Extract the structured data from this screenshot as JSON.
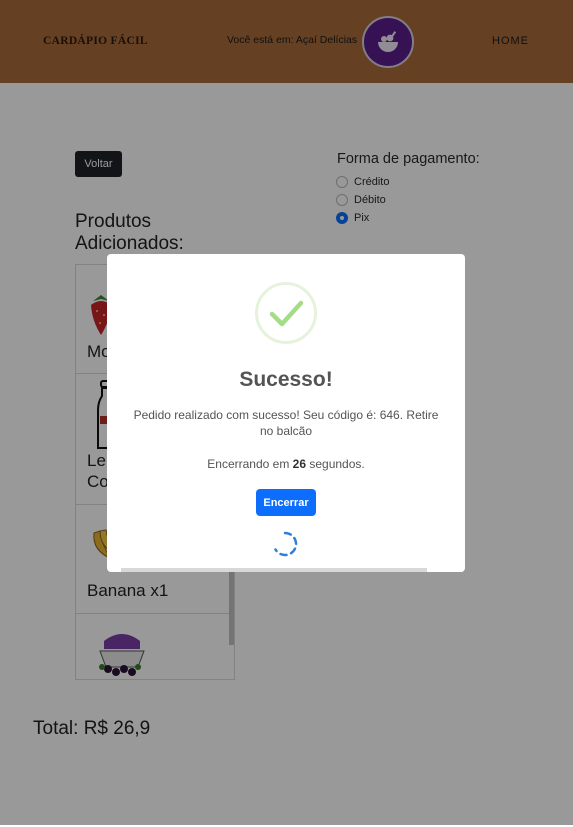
{
  "header": {
    "brand": "CARDÁPIO FÁCIL",
    "store_info": "Você está em: Açaí Delícias",
    "home": "HOME"
  },
  "nav": {
    "back_label": "Voltar"
  },
  "payment": {
    "title": "Forma de pagamento:",
    "options": [
      {
        "label": "Crédito",
        "selected": false
      },
      {
        "label": "Débito",
        "selected": false
      },
      {
        "label": "Pix",
        "selected": true
      }
    ]
  },
  "products": {
    "title": "Produtos Adicionados:",
    "items": [
      {
        "name": "Mo",
        "icon": "strawberry-icon"
      },
      {
        "name": "Le Co",
        "icon": "milk-bottle-icon"
      },
      {
        "name": "Banana x1",
        "icon": "banana-icon"
      },
      {
        "name": "",
        "icon": "acai-bowl-icon"
      }
    ]
  },
  "total": "Total: R$ 26,9",
  "modal": {
    "title": "Sucesso!",
    "message": "Pedido realizado com sucesso! Seu código é: 646. Retire no balcão",
    "timer_prefix": "Encerrando em ",
    "timer_seconds": "26",
    "timer_suffix": " segundos.",
    "close_label": "Encerrar"
  },
  "colors": {
    "header_bg": "#a86b3a",
    "store_avatar": "#5b1f8c",
    "primary": "#0d6efd",
    "success": "#a5dc86",
    "button_dark": "#1f2227"
  }
}
